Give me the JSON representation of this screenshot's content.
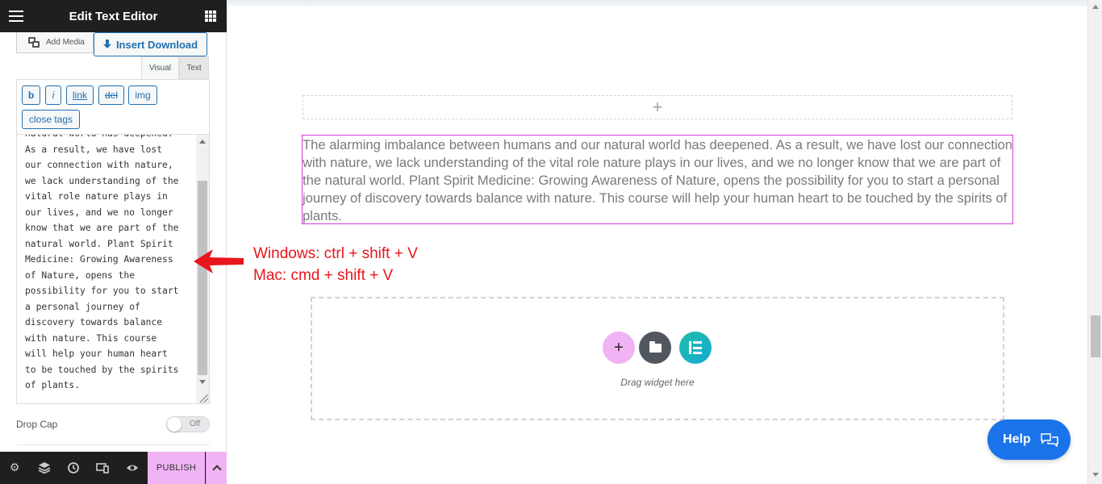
{
  "panel": {
    "title": "Edit Text Editor",
    "add_media_label": "Add Media",
    "insert_download_label": "Insert Download",
    "tabs": {
      "visual": "Visual",
      "text": "Text"
    },
    "quicktags": {
      "bold": "b",
      "italic": "i",
      "link": "link",
      "del": "del",
      "img": "img",
      "close_tags": "close tags"
    },
    "editor_text": "natural world has deepened.\nAs a result, we have lost\nour connection with nature,\nwe lack understanding of the\nvital role nature plays in\nour lives, and we no longer\nknow that we are part of the\nnatural world. Plant Spirit\nMedicine: Growing Awareness\nof Nature, opens the\npossibility for you to start\na personal journey of\ndiscovery towards balance\nwith nature. This course\nwill help your human heart\nto be touched by the spirits\nof plants.",
    "drop_cap_label": "Drop Cap",
    "drop_cap_state": "Off",
    "footer": {
      "icons": [
        "settings-icon",
        "layers-icon",
        "history-icon",
        "responsive-icon",
        "preview-icon"
      ],
      "publish_label": "PUBLISH"
    }
  },
  "canvas": {
    "add_section_symbol": "+",
    "text_widget_content": "The alarming imbalance between humans and our natural world has deepened. As a result, we have lost our connection with nature, we lack understanding of the vital role nature plays in our lives, and we no longer know that we are part of the natural world. Plant Spirit Medicine: Growing Awareness of Nature, opens the possibility for you to start a personal journey of discovery towards balance with nature. This course will help your human heart to be touched by the spirits of plants.",
    "add_widget_symbol": "+",
    "drag_hint": "Drag widget here"
  },
  "annotation": {
    "windows": "Windows: ctrl + shift + V",
    "mac": "Mac: cmd + shift + V",
    "color": "#e8161b"
  },
  "help_label": "Help",
  "colors": {
    "accent_pink": "#f0b3f4",
    "wp_blue": "#2271b1",
    "widget_border": "#d63bd6",
    "help_blue": "#1a73e8"
  }
}
